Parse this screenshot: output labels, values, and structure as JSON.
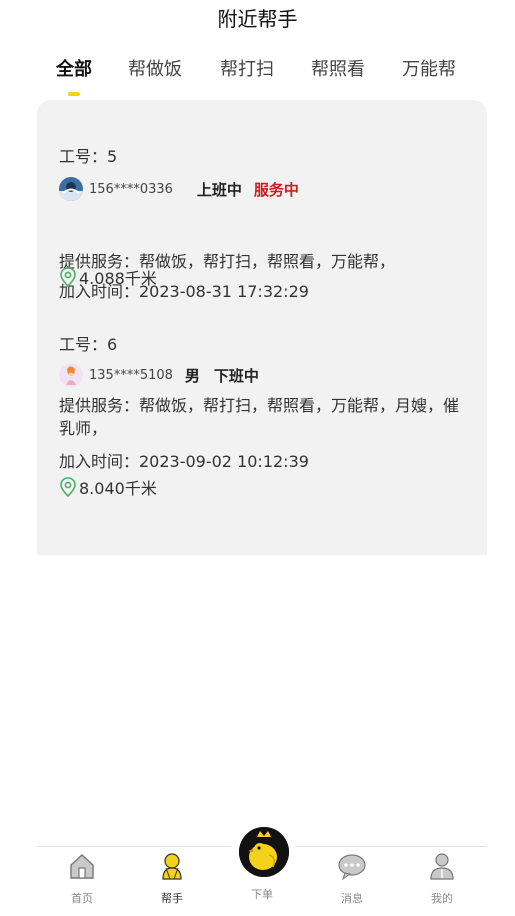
{
  "header": {
    "title": "附近帮手"
  },
  "tabs": [
    {
      "label": "全部",
      "active": true
    },
    {
      "label": "帮做饭",
      "active": false
    },
    {
      "label": "帮打扫",
      "active": false
    },
    {
      "label": "帮照看",
      "active": false
    },
    {
      "label": "万能帮",
      "active": false
    }
  ],
  "helpers": [
    {
      "id_text": "工号：5",
      "phone": "156****0336",
      "work_status": "上班中",
      "service_status": "服务中",
      "services": "提供服务：帮做饭，帮打扫，帮照看，万能帮，",
      "joined": "加入时间：2023-08-31 17:32:29",
      "distance": "4.088千米"
    },
    {
      "id_text": "工号：6",
      "phone": "135****5108",
      "gender": "男",
      "work_status": "下班中",
      "services": "提供服务：帮做饭，帮打扫，帮照看，万能帮，月嫂，催乳师，",
      "joined": "加入时间：2023-09-02 10:12:39",
      "distance": "8.040千米"
    }
  ],
  "tabbar": {
    "items": [
      {
        "label": "首页",
        "icon": "house-icon"
      },
      {
        "label": "帮手",
        "icon": "helper-icon",
        "active": true
      },
      {
        "label": "下单",
        "icon": "order-icon"
      },
      {
        "label": "消息",
        "icon": "chat-bubble-icon"
      },
      {
        "label": "我的",
        "icon": "person-icon"
      }
    ]
  },
  "colors": {
    "accent_yellow": "#f5d21a",
    "status_red": "#d41a1a",
    "panel_bg": "#f2f2f2"
  }
}
